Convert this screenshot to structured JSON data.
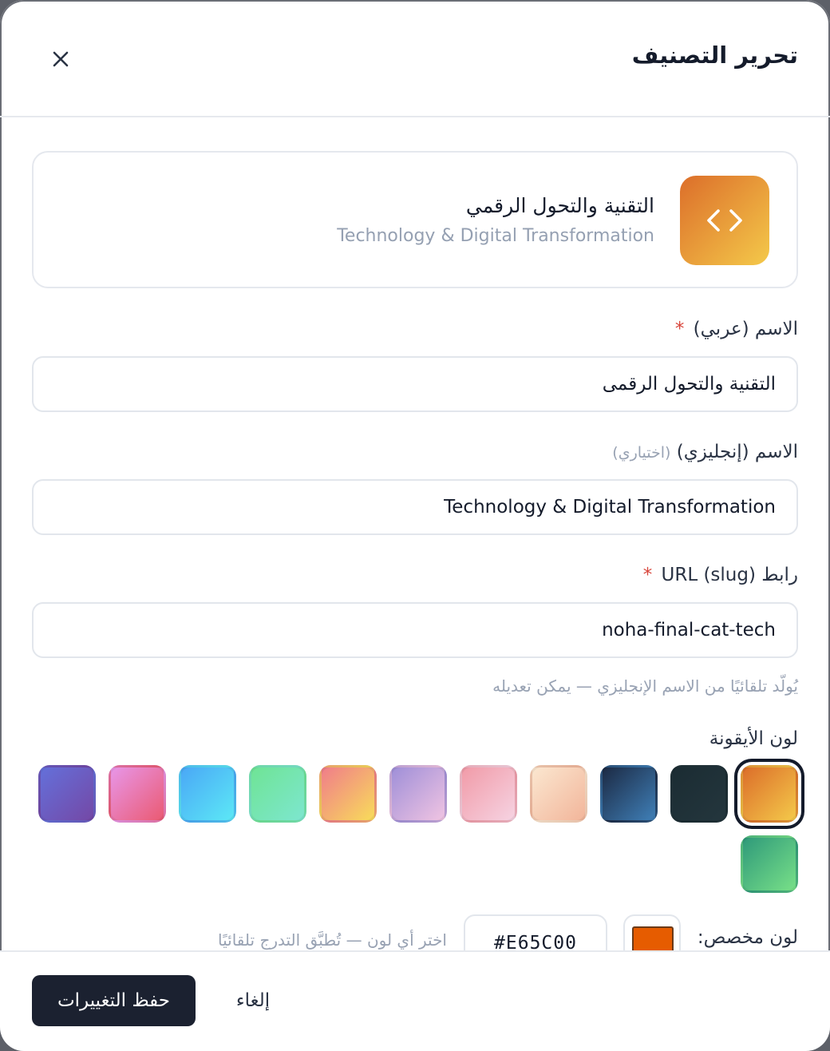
{
  "header": {
    "title": "تحرير التصنيف"
  },
  "preview": {
    "name_ar": "التقنية والتحول الرقمي",
    "name_en": "Technology & Digital Transformation",
    "icon": "code-icon"
  },
  "form": {
    "name_ar": {
      "label": "الاسم (عربي)",
      "required_mark": "*",
      "value": "التقنية والتحول الرقمى"
    },
    "name_en": {
      "label": "الاسم (إنجليزي)",
      "optional": "(اختياري)",
      "value": "Technology & Digital Transformation"
    },
    "slug": {
      "label": "رابط URL (slug)",
      "required_mark": "*",
      "value": "noha-final-cat-tech",
      "hint": "يُولّد تلقائيًا من الاسم الإنجليزي — يمكن تعديله"
    },
    "icon_color": {
      "label": "لون الأيقونة",
      "swatches": [
        {
          "from": "#dc6e2a",
          "to": "#f4c94a",
          "selected": true
        },
        {
          "from": "#1b2c33",
          "to": "#24363d",
          "selected": false
        },
        {
          "from": "#1c2a44",
          "to": "#3f7fb7",
          "selected": false
        },
        {
          "from": "#fbe7d0",
          "to": "#f2b59a",
          "selected": false
        },
        {
          "from": "#f19ba8",
          "to": "#f6d3e2",
          "selected": false
        },
        {
          "from": "#9f8fd8",
          "to": "#f0c4e2",
          "selected": false
        },
        {
          "from": "#f07d8a",
          "to": "#f8dc5a",
          "selected": false
        },
        {
          "from": "#6fe495",
          "to": "#7de6cf",
          "selected": false
        },
        {
          "from": "#4aa8f6",
          "to": "#5ce8f6",
          "selected": false
        },
        {
          "from": "#e896e8",
          "to": "#ea5a72",
          "selected": false
        },
        {
          "from": "#6470da",
          "to": "#7448a6",
          "selected": false
        },
        {
          "from": "#2f9a7a",
          "to": "#78e088",
          "selected": false
        }
      ],
      "custom_label": "لون مخصص:",
      "custom_value": "#E65C00",
      "custom_hint": "اختر أي لون — تُطبَّق التدرج تلقائيًا"
    }
  },
  "footer": {
    "save_label": "حفظ التغييرات",
    "cancel_label": "إلغاء"
  }
}
